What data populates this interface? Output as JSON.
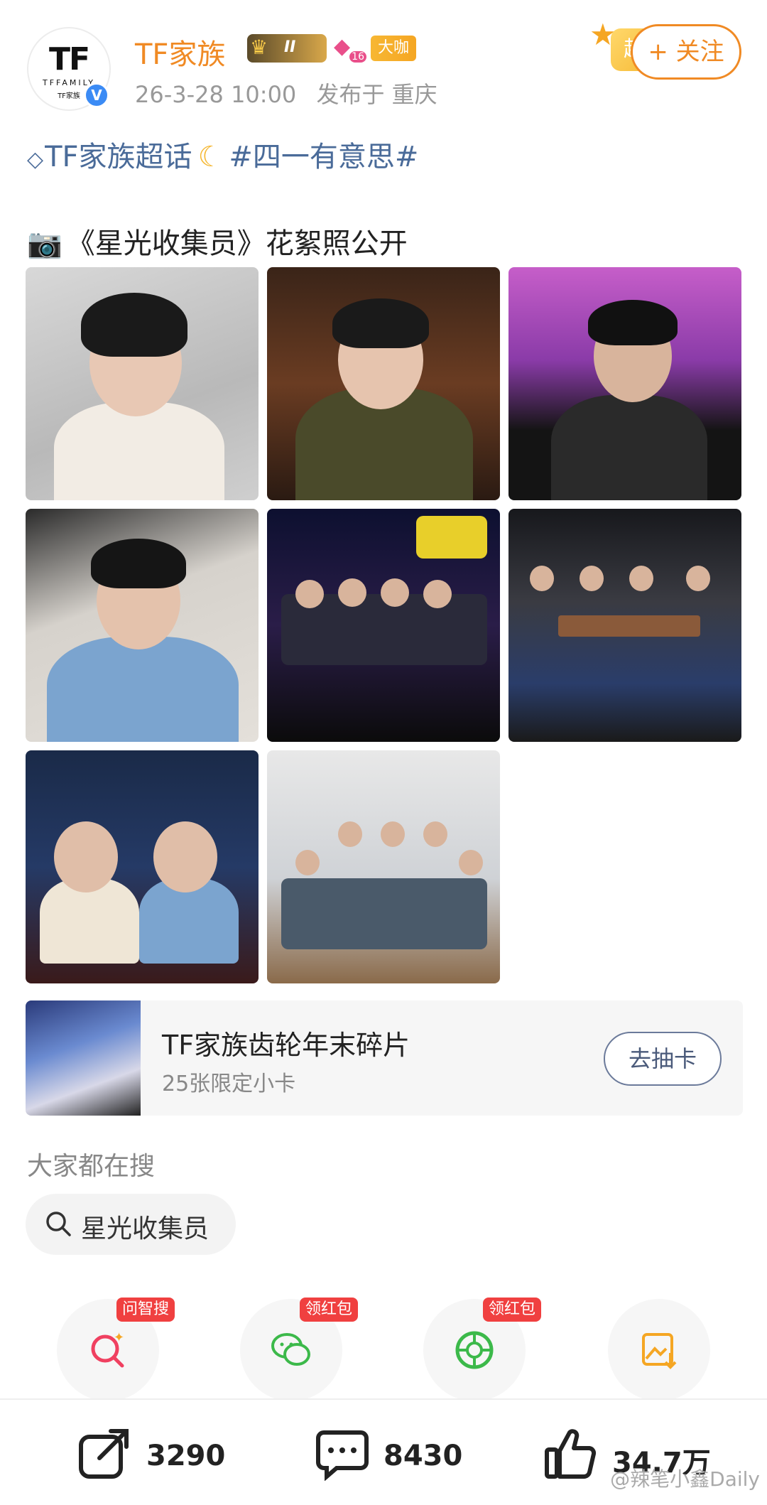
{
  "header": {
    "avatar_logo": "TF",
    "avatar_sub1": "TFFAMILY",
    "avatar_sub2": "TF家族",
    "username": "TF家族",
    "level_badge": "II",
    "gem_badge_num": "16",
    "vip_badge": "大咖",
    "date": "26-3-28 10:00",
    "location": "发布于 重庆",
    "follow_deco_text": "超",
    "follow_button": "+ 关注"
  },
  "post": {
    "topic": "TF家族超话",
    "hashtag": "#四一有意思#",
    "caption_icon": "camera-icon",
    "caption": "《星光收集员》花絮照公开"
  },
  "card": {
    "title": "TF家族齿轮年末碎片",
    "subtitle": "25张限定小卡",
    "button": "去抽卡"
  },
  "search": {
    "title": "大家都在搜",
    "chip": "星光收集员"
  },
  "actions": [
    {
      "tag": "问智搜",
      "icon": "ai-search-icon",
      "color": "#f04060"
    },
    {
      "tag": "领红包",
      "icon": "wechat-icon",
      "color": "#3cb94a"
    },
    {
      "tag": "领红包",
      "icon": "moments-icon",
      "color": "#3cb94a"
    },
    {
      "tag": "",
      "icon": "save-image-icon",
      "color": "#f5a623"
    }
  ],
  "stats": {
    "shares": "3290",
    "comments": "8430",
    "likes": "34.7万"
  },
  "watermark": "@辣笔小鑫Daily",
  "colors": {
    "accent": "#f08a24",
    "link": "#4a6b99",
    "red": "#f04040"
  }
}
